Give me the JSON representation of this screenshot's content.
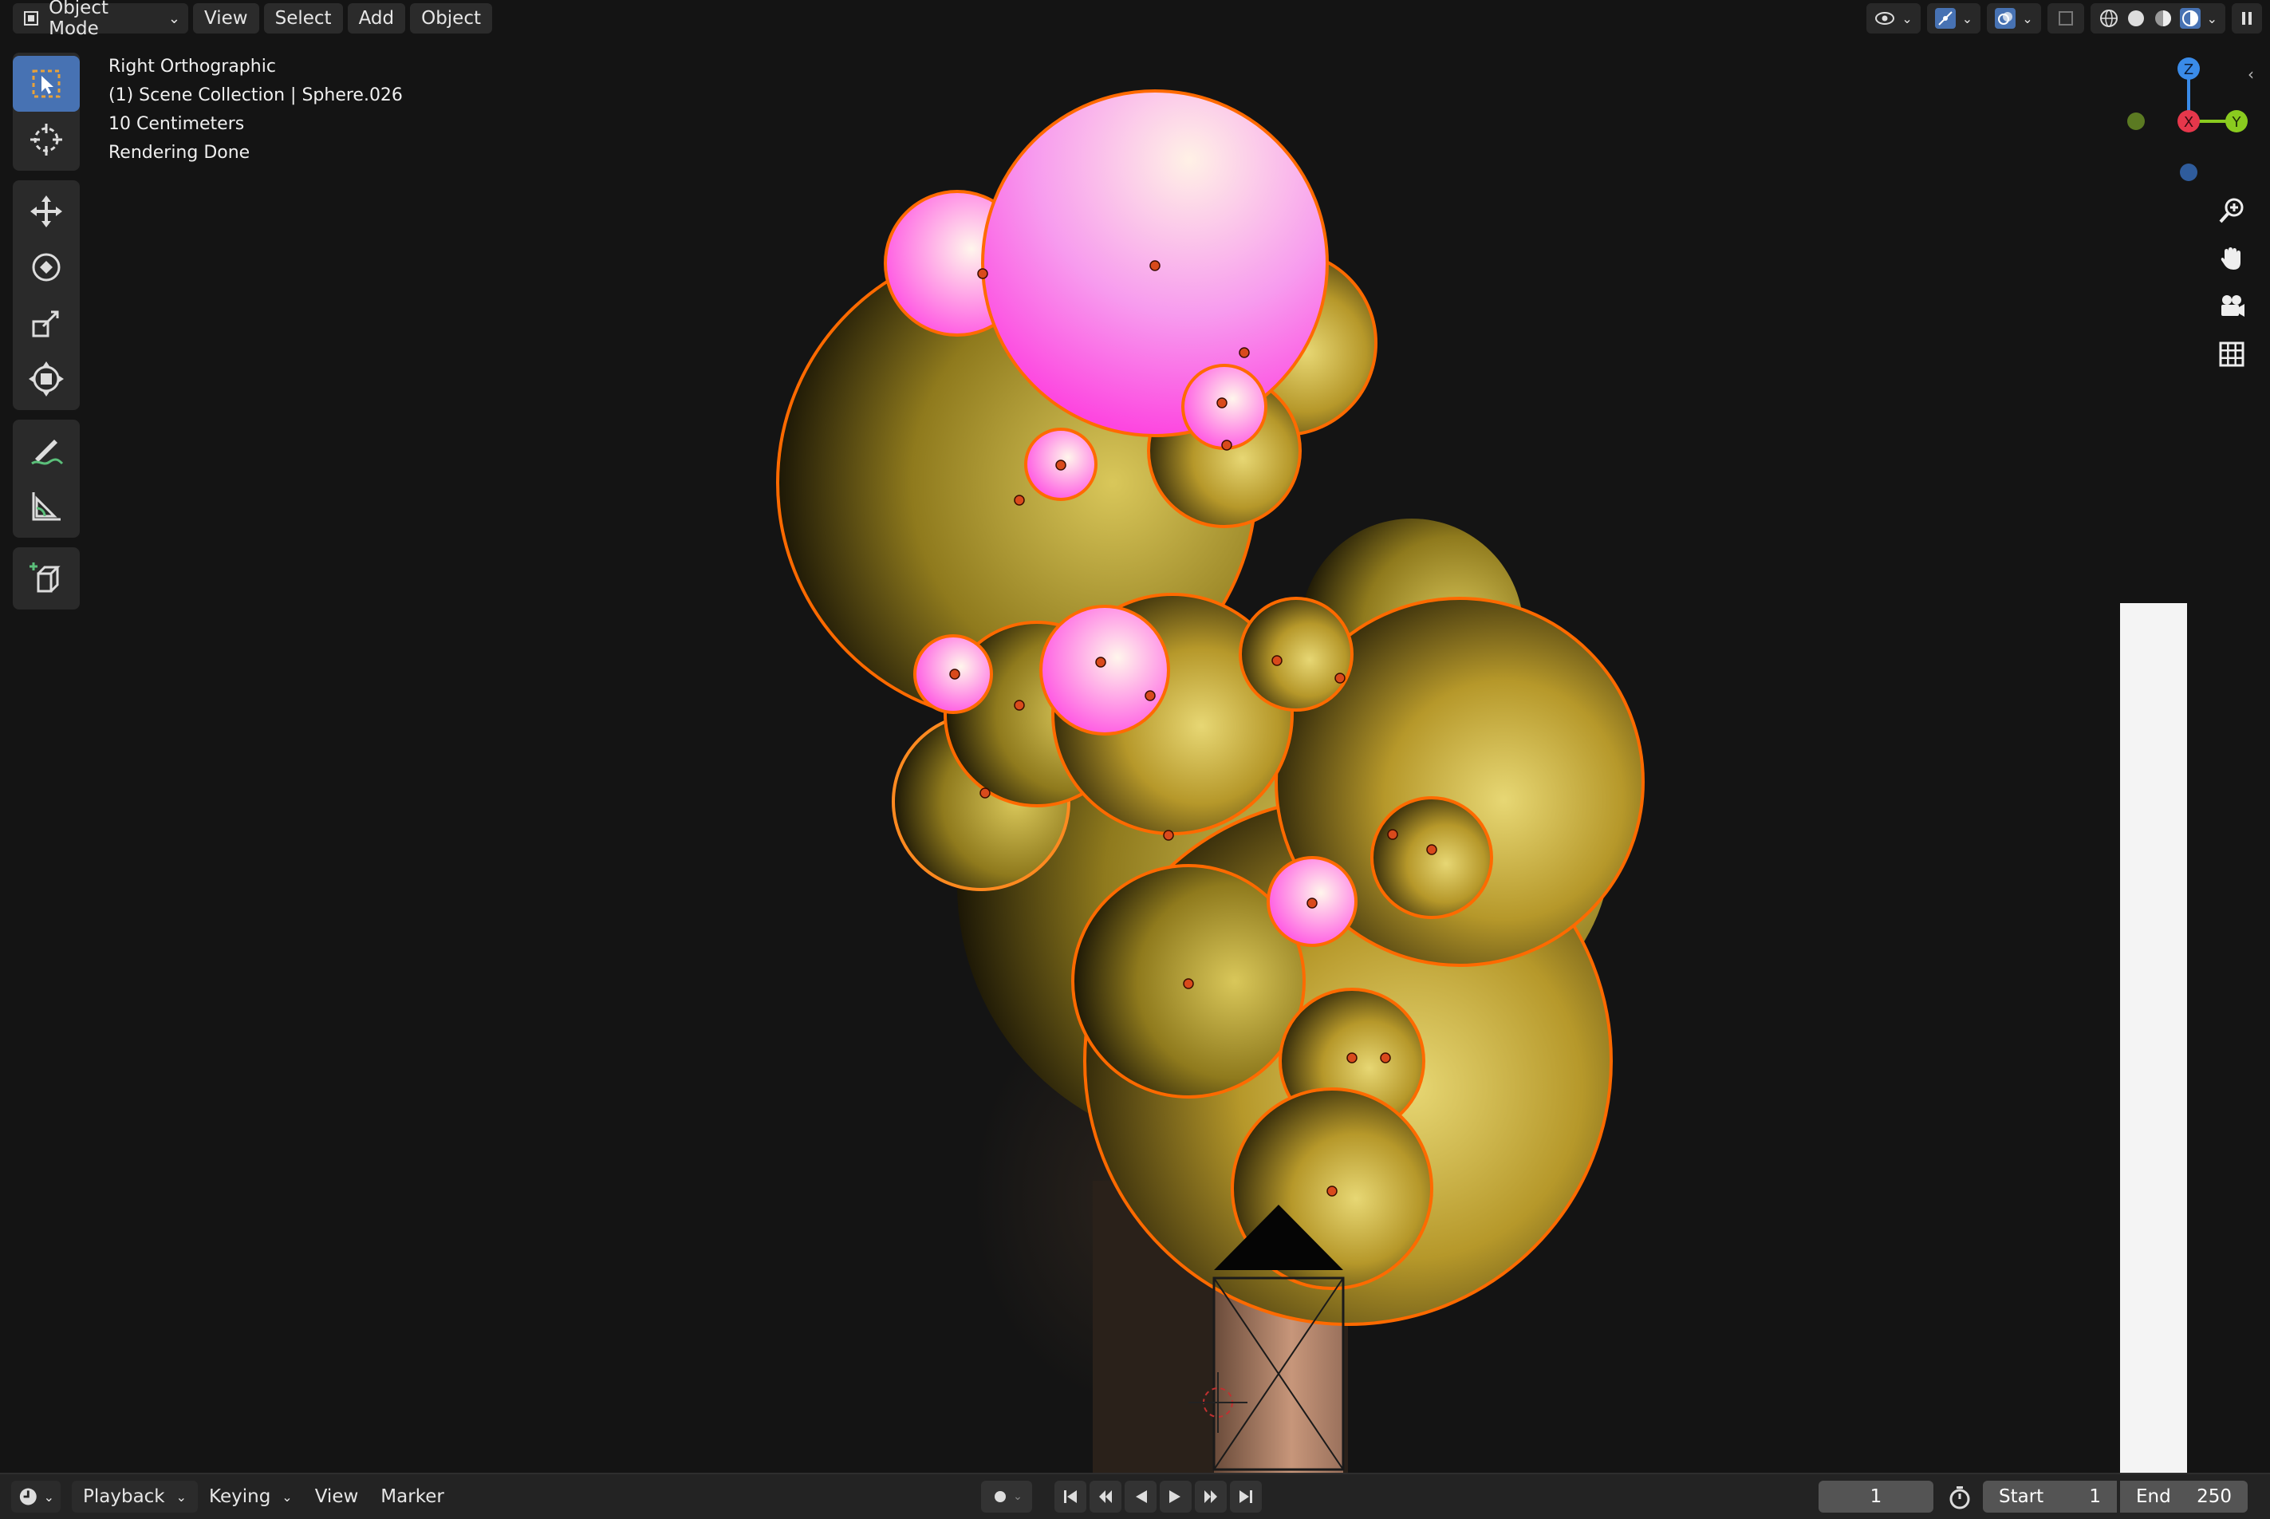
{
  "header": {
    "mode_label": "Object Mode",
    "menu": [
      "View",
      "Select",
      "Add",
      "Object"
    ]
  },
  "overlay": {
    "view_name": "Right Orthographic",
    "collection": "(1) Scene Collection | Sphere.026",
    "scale": "10 Centimeters",
    "status": "Rendering Done"
  },
  "gizmo": {
    "z": "Z",
    "x": "X",
    "y": "Y"
  },
  "toolbar": {
    "tools": [
      "select-box-icon",
      "cursor-icon",
      "move-icon",
      "rotate-icon",
      "scale-icon",
      "transform-icon",
      "annotate-icon",
      "measure-icon",
      "add-cube-icon"
    ]
  },
  "timeline": {
    "playback_label": "Playback",
    "keying_label": "Keying",
    "view_label": "View",
    "marker_label": "Marker",
    "current_frame": "1",
    "start_label": "Start",
    "start_value": "1",
    "end_label": "End",
    "end_value": "250"
  },
  "colors": {
    "accent": "#4772b3",
    "selection_outline": "#ff6a00",
    "bubble_yellow": "#c9b02a",
    "bubble_pink": "#ff4de3",
    "axis_x": "#e6374b",
    "axis_y": "#8acb1f",
    "axis_z": "#3a8be8"
  }
}
